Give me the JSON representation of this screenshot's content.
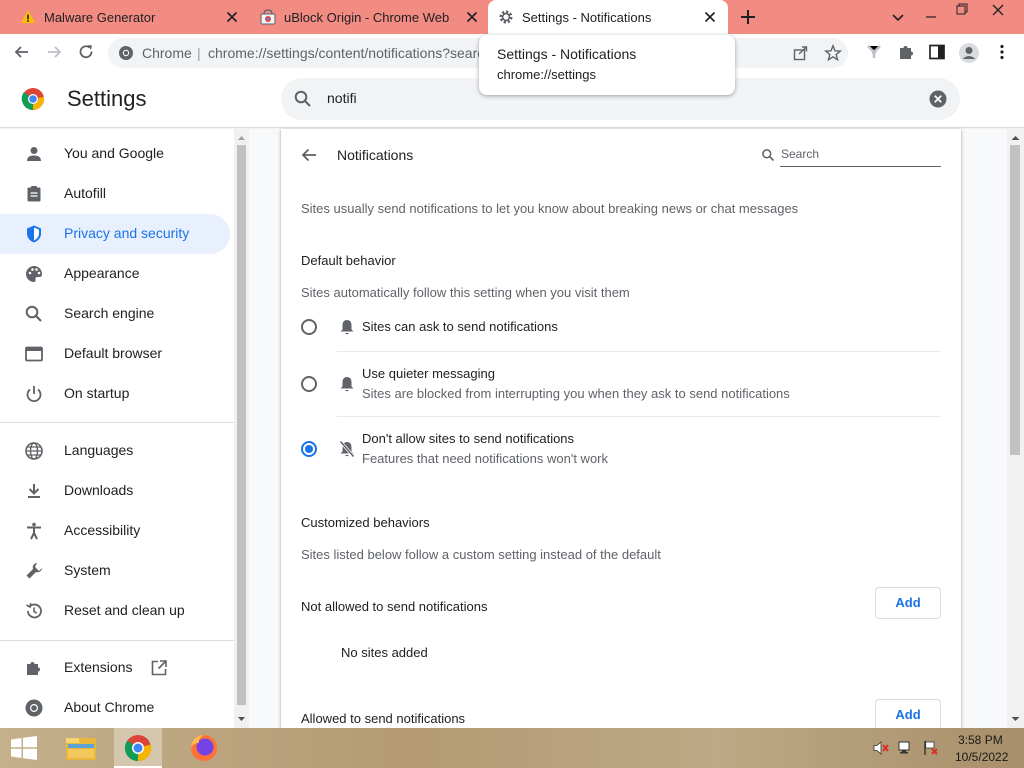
{
  "tabs": [
    {
      "title": "Malware Generator",
      "icon": "warning-icon",
      "active": false
    },
    {
      "title": "uBlock Origin - Chrome Web Sto",
      "icon": "webstore-icon",
      "active": false
    },
    {
      "title": "Settings - Notifications",
      "icon": "gear-icon",
      "active": true
    }
  ],
  "new_tab_label": "+",
  "toolbar": {
    "omnibox_chrome_label": "Chrome",
    "omnibox_separator": "|",
    "omnibox_url": "chrome://settings/content/notifications?search"
  },
  "tooltip": {
    "title": "Settings - Notifications",
    "url": "chrome://settings"
  },
  "settings_header": {
    "title": "Settings",
    "search_value": "notifi"
  },
  "sidebar": {
    "items": [
      {
        "label": "You and Google",
        "icon": "person-icon"
      },
      {
        "label": "Autofill",
        "icon": "clipboard-icon"
      },
      {
        "label": "Privacy and security",
        "icon": "shield-icon",
        "selected": true
      },
      {
        "label": "Appearance",
        "icon": "palette-icon"
      },
      {
        "label": "Search engine",
        "icon": "search-icon"
      },
      {
        "label": "Default browser",
        "icon": "browser-icon"
      },
      {
        "label": "On startup",
        "icon": "power-icon"
      },
      {
        "label": "Languages",
        "icon": "globe-icon"
      },
      {
        "label": "Downloads",
        "icon": "download-icon"
      },
      {
        "label": "Accessibility",
        "icon": "accessibility-icon"
      },
      {
        "label": "System",
        "icon": "wrench-icon"
      },
      {
        "label": "Reset and clean up",
        "icon": "history-icon"
      },
      {
        "label": "Extensions",
        "icon": "puzzle-icon"
      },
      {
        "label": "About Chrome",
        "icon": "chrome-icon"
      }
    ]
  },
  "notifications": {
    "title": "Notifications",
    "search_placeholder": "Search",
    "description": "Sites usually send notifications to let you know about breaking news or chat messages",
    "default_behavior": {
      "heading": "Default behavior",
      "subheading": "Sites automatically follow this setting when you visit them",
      "options": [
        {
          "label": "Sites can ask to send notifications",
          "sublabel": "",
          "icon": "bell-icon",
          "selected": false
        },
        {
          "label": "Use quieter messaging",
          "sublabel": "Sites are blocked from interrupting you when they ask to send notifications",
          "icon": "bell-icon",
          "selected": false
        },
        {
          "label": "Don't allow sites to send notifications",
          "sublabel": "Features that need notifications won't work",
          "icon": "bell-off-icon",
          "selected": true
        }
      ]
    },
    "customized": {
      "heading": "Customized behaviors",
      "subheading": "Sites listed below follow a custom setting instead of the default",
      "not_allowed_label": "Not allowed to send notifications",
      "not_allowed_empty": "No sites added",
      "allowed_label": "Allowed to send notifications",
      "add_label": "Add"
    }
  },
  "taskbar": {
    "apps": [
      "start-icon",
      "file-explorer-icon",
      "chrome-icon",
      "firefox-icon"
    ],
    "time": "3:58 PM",
    "date": "10/5/2022"
  },
  "colors": {
    "tab_strip": "#f28b82",
    "accent": "#1a73e8",
    "selected_nav_bg": "#e8f0fe"
  }
}
